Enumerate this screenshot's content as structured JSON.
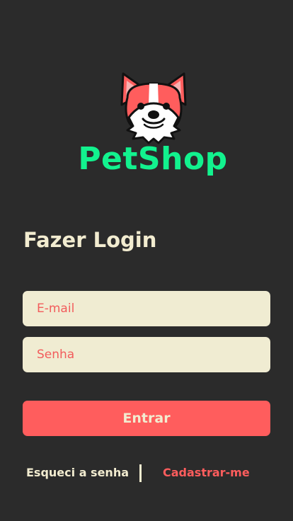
{
  "brand": {
    "name": "PetShop",
    "logo_icon": "corgi-head-icon",
    "name_color": "#12f28e"
  },
  "login": {
    "title": "Fazer Login",
    "email_placeholder": "E-mail",
    "password_placeholder": "Senha",
    "submit_label": "Entrar"
  },
  "links": {
    "forgot_password": "Esqueci a senha",
    "register": "Cadastrar-me"
  },
  "colors": {
    "background": "#2b2b2b",
    "accent": "#ff5d5d",
    "input_bg": "#f0ecd2",
    "text_light": "#f2ecd0"
  }
}
